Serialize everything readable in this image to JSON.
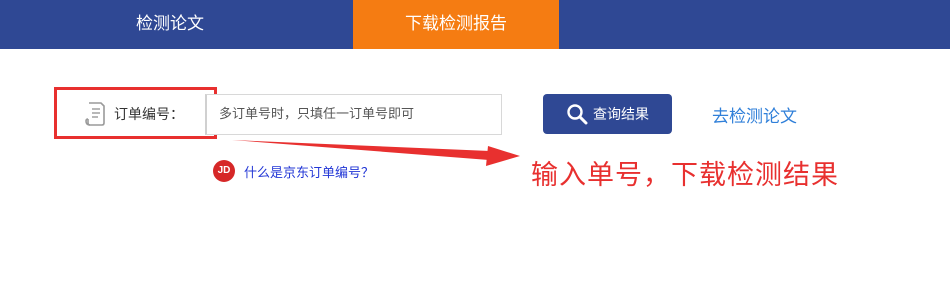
{
  "tabs": [
    {
      "label": "检测论文"
    },
    {
      "label": "下载检测报告",
      "active": true
    }
  ],
  "order": {
    "label": "订单编号：",
    "placeholder": "多订单号时，只填任一订单号即可"
  },
  "buttons": {
    "query_label": "查询结果",
    "goto_label": "去检测论文"
  },
  "jd": {
    "badge": "JD",
    "link_text": "什么是京东订单编号？"
  },
  "annotation": {
    "text": "输入单号，下载检测结果"
  },
  "colors": {
    "nav_bg": "#2f4894",
    "active_tab": "#f57c12",
    "highlight": "#e8302f",
    "link": "#2f7fd9",
    "jd_red": "#d62828"
  }
}
